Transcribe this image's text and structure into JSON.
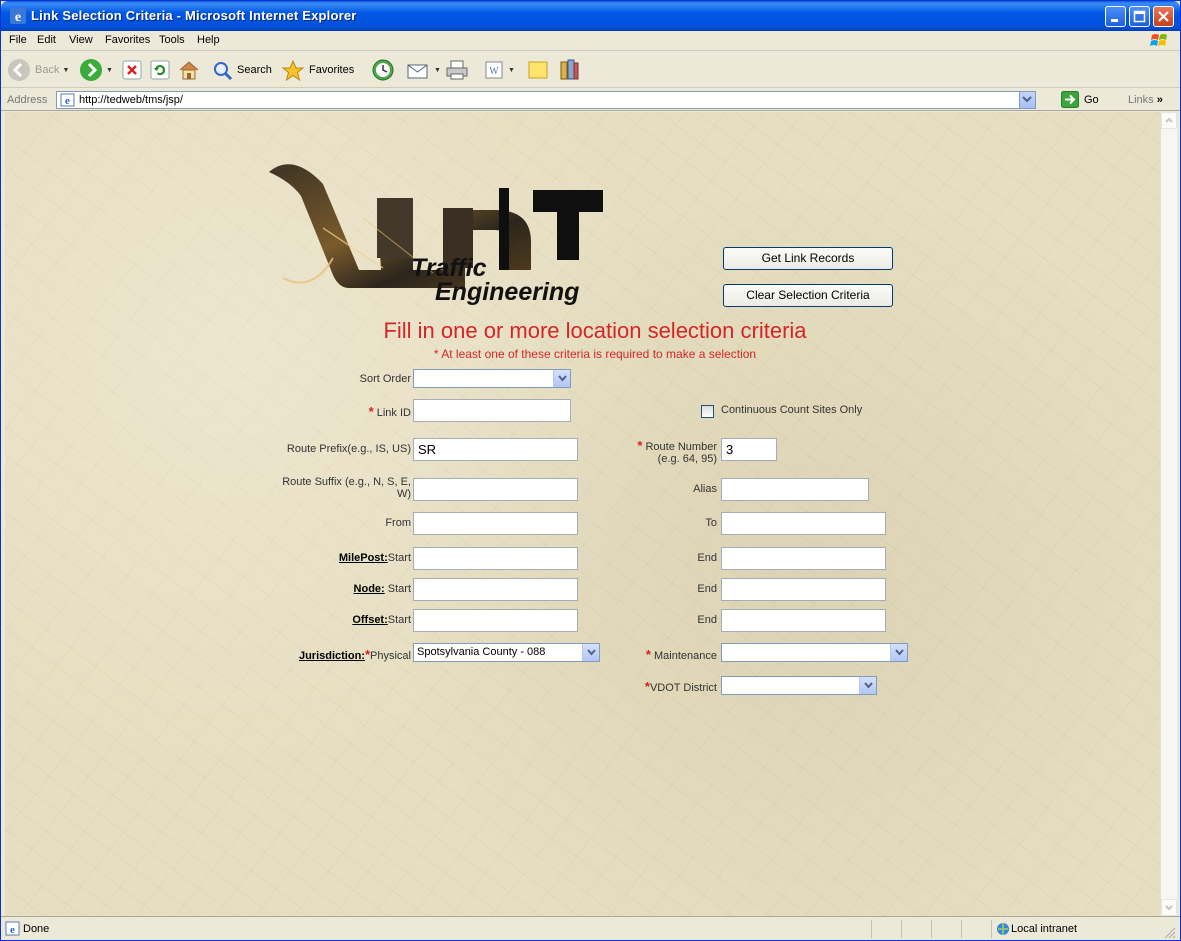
{
  "window": {
    "title": "Link Selection Criteria - Microsoft Internet Explorer"
  },
  "menu": {
    "items": [
      "File",
      "Edit",
      "View",
      "Favorites",
      "Tools",
      "Help"
    ]
  },
  "toolbar": {
    "back": "Back",
    "search": "Search",
    "favorites": "Favorites"
  },
  "address": {
    "label": "Address",
    "url": "http://tedweb/tms/jsp/",
    "go": "Go",
    "links": "Links"
  },
  "status": {
    "text": "Done",
    "zone": "Local intranet"
  },
  "logo": {
    "brand": "VDOT",
    "line1": "Traffic",
    "line2": "Engineering"
  },
  "buttons": {
    "get_records": "Get Link Records",
    "clear": "Clear Selection Criteria"
  },
  "heading": "Fill in one or more location selection criteria",
  "subheading": "* At least one of these criteria is required to make a selection",
  "form": {
    "sort_order": {
      "label": "Sort Order",
      "value": ""
    },
    "link_id": {
      "label": "Link ID",
      "value": ""
    },
    "continuous_only": {
      "label": "Continuous Count Sites Only",
      "checked": false
    },
    "route_prefix": {
      "label": "Route Prefix(e.g., IS, US)",
      "value": "SR"
    },
    "route_number": {
      "label1": "Route Number",
      "label2": "(e.g. 64, 95)",
      "value": "3"
    },
    "route_suffix": {
      "label1": "Route Suffix (e.g., N, S, E,",
      "label2": "W)",
      "value": ""
    },
    "alias": {
      "label": "Alias",
      "value": ""
    },
    "from": {
      "label": "From",
      "value": ""
    },
    "to": {
      "label": "To",
      "value": ""
    },
    "milepost": {
      "heading": "MilePost:",
      "start": "Start",
      "end": "End"
    },
    "node": {
      "heading": "Node:",
      "start": "Start",
      "end": "End"
    },
    "offset": {
      "heading": "Offset:",
      "start": "Start",
      "end": "End"
    },
    "jurisdiction": {
      "heading": "Jurisdiction:",
      "physical_label": "Physical",
      "physical_value": "Spotsylvania County - 088",
      "maintenance_label": "Maintenance",
      "maintenance_value": "",
      "district_label": "VDOT District",
      "district_value": ""
    }
  },
  "colors": {
    "heading": "#d42626",
    "titlebar": "#0058e6"
  }
}
